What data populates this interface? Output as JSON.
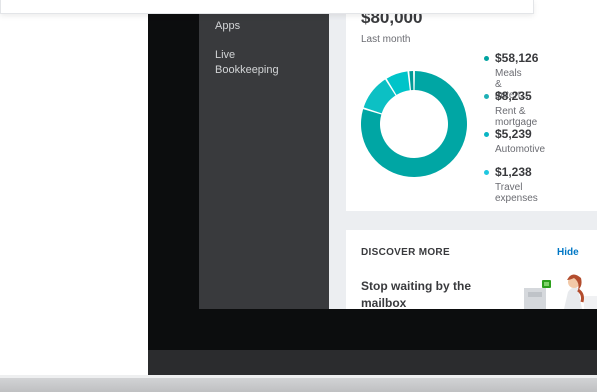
{
  "sidebar": {
    "items": [
      {
        "label": "Apps"
      },
      {
        "label": "Live"
      },
      {
        "label": "Bookkeeping"
      }
    ]
  },
  "expenses": {
    "amount": "$80,000",
    "period": "Last month",
    "chart_data": {
      "type": "pie",
      "categories": [
        "Meals & entert...",
        "Rent & mortgage",
        "Automotive",
        "Travel expenses"
      ],
      "values": [
        58126,
        8235,
        5239,
        1238
      ],
      "colors": [
        "#00a6a4",
        "#0cc0c4",
        "#00c4c9",
        "#009a96"
      ]
    },
    "legend": [
      {
        "value": "$58,126",
        "label": "Meals & entert...",
        "color": "#00a3a0"
      },
      {
        "value": "$8,235",
        "label": "Rent & mortgage",
        "color": "#1fb0b6"
      },
      {
        "value": "$5,239",
        "label": "Automotive",
        "color": "#0ab5c4"
      },
      {
        "value": "$1,238",
        "label": "Travel expenses",
        "color": "#20c7e0"
      }
    ]
  },
  "discover": {
    "title": "DISCOVER MORE",
    "hide_label": "Hide",
    "message": "Stop waiting by the mailbox"
  }
}
